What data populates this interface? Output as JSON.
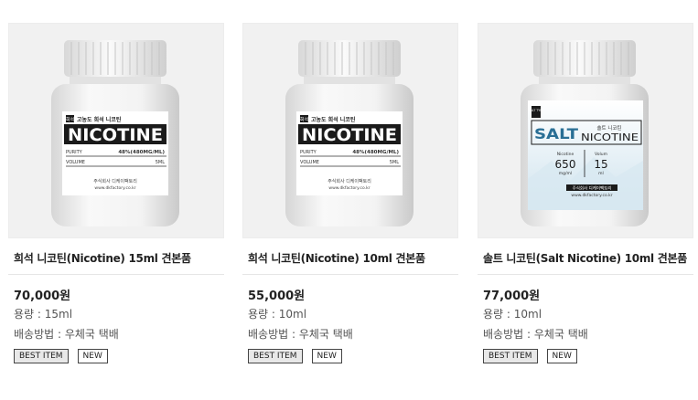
{
  "products": [
    {
      "name": "희석 니코틴(Nicotine) 15ml 견본품",
      "price": "70,000원",
      "volume": "용량 : 15ml",
      "shipping": "배송방법 : 우체국 택배",
      "badges": [
        "BEST ITEM",
        "NEW"
      ],
      "label": {
        "tag": "희석",
        "subtitle": "고농도 희석 니코틴",
        "brand": "NICOTINE",
        "purity_label": "PURITY",
        "purity_value": "48%(480MG/ML)",
        "volume_label": "VOLUME",
        "volume_value": "5ML",
        "company": "주식회사 디케이팩토리",
        "website": "www.dkfactory.co.kr"
      }
    },
    {
      "name": "희석 니코틴(Nicotine) 10ml 견본품",
      "price": "55,000원",
      "volume": "용량 : 10ml",
      "shipping": "배송방법 : 우체국 택배",
      "badges": [
        "BEST ITEM",
        "NEW"
      ],
      "label": {
        "tag": "희석",
        "subtitle": "고농도 희석 니코틴",
        "brand": "NICOTINE",
        "purity_label": "PURITY",
        "purity_value": "48%(480MG/ML)",
        "volume_label": "VOLUME",
        "volume_value": "5ML",
        "company": "주식회사 디케이팩토리",
        "website": "www.dkfactory.co.kr"
      }
    },
    {
      "name": "솔트 니코틴(Salt Nicotine) 10ml 견본품",
      "price": "77,000원",
      "volume": "용량 : 10ml",
      "shipping": "배송방법 : 우체국 택배",
      "badges": [
        "BEST ITEM",
        "NEW"
      ],
      "label": {
        "tag": "SALT TYPE",
        "brand_salt": "SALT",
        "brand_korean": "솔트 니코틴",
        "brand_nicotine": "NICOTINE",
        "nicotine_label": "Nicotine",
        "nicotine_value": "650",
        "nicotine_unit": "mg/ml",
        "volume_label": "Volum",
        "volume_value": "15",
        "volume_unit": "ml",
        "company": "주식회사 디케이팩토리",
        "website": "www.dkfactory.co.kr"
      }
    }
  ],
  "colors": {
    "salt_brand": "#2a6f95",
    "label_black": "#1a1a1a",
    "badge_best_bg": "#e8e8e8"
  }
}
